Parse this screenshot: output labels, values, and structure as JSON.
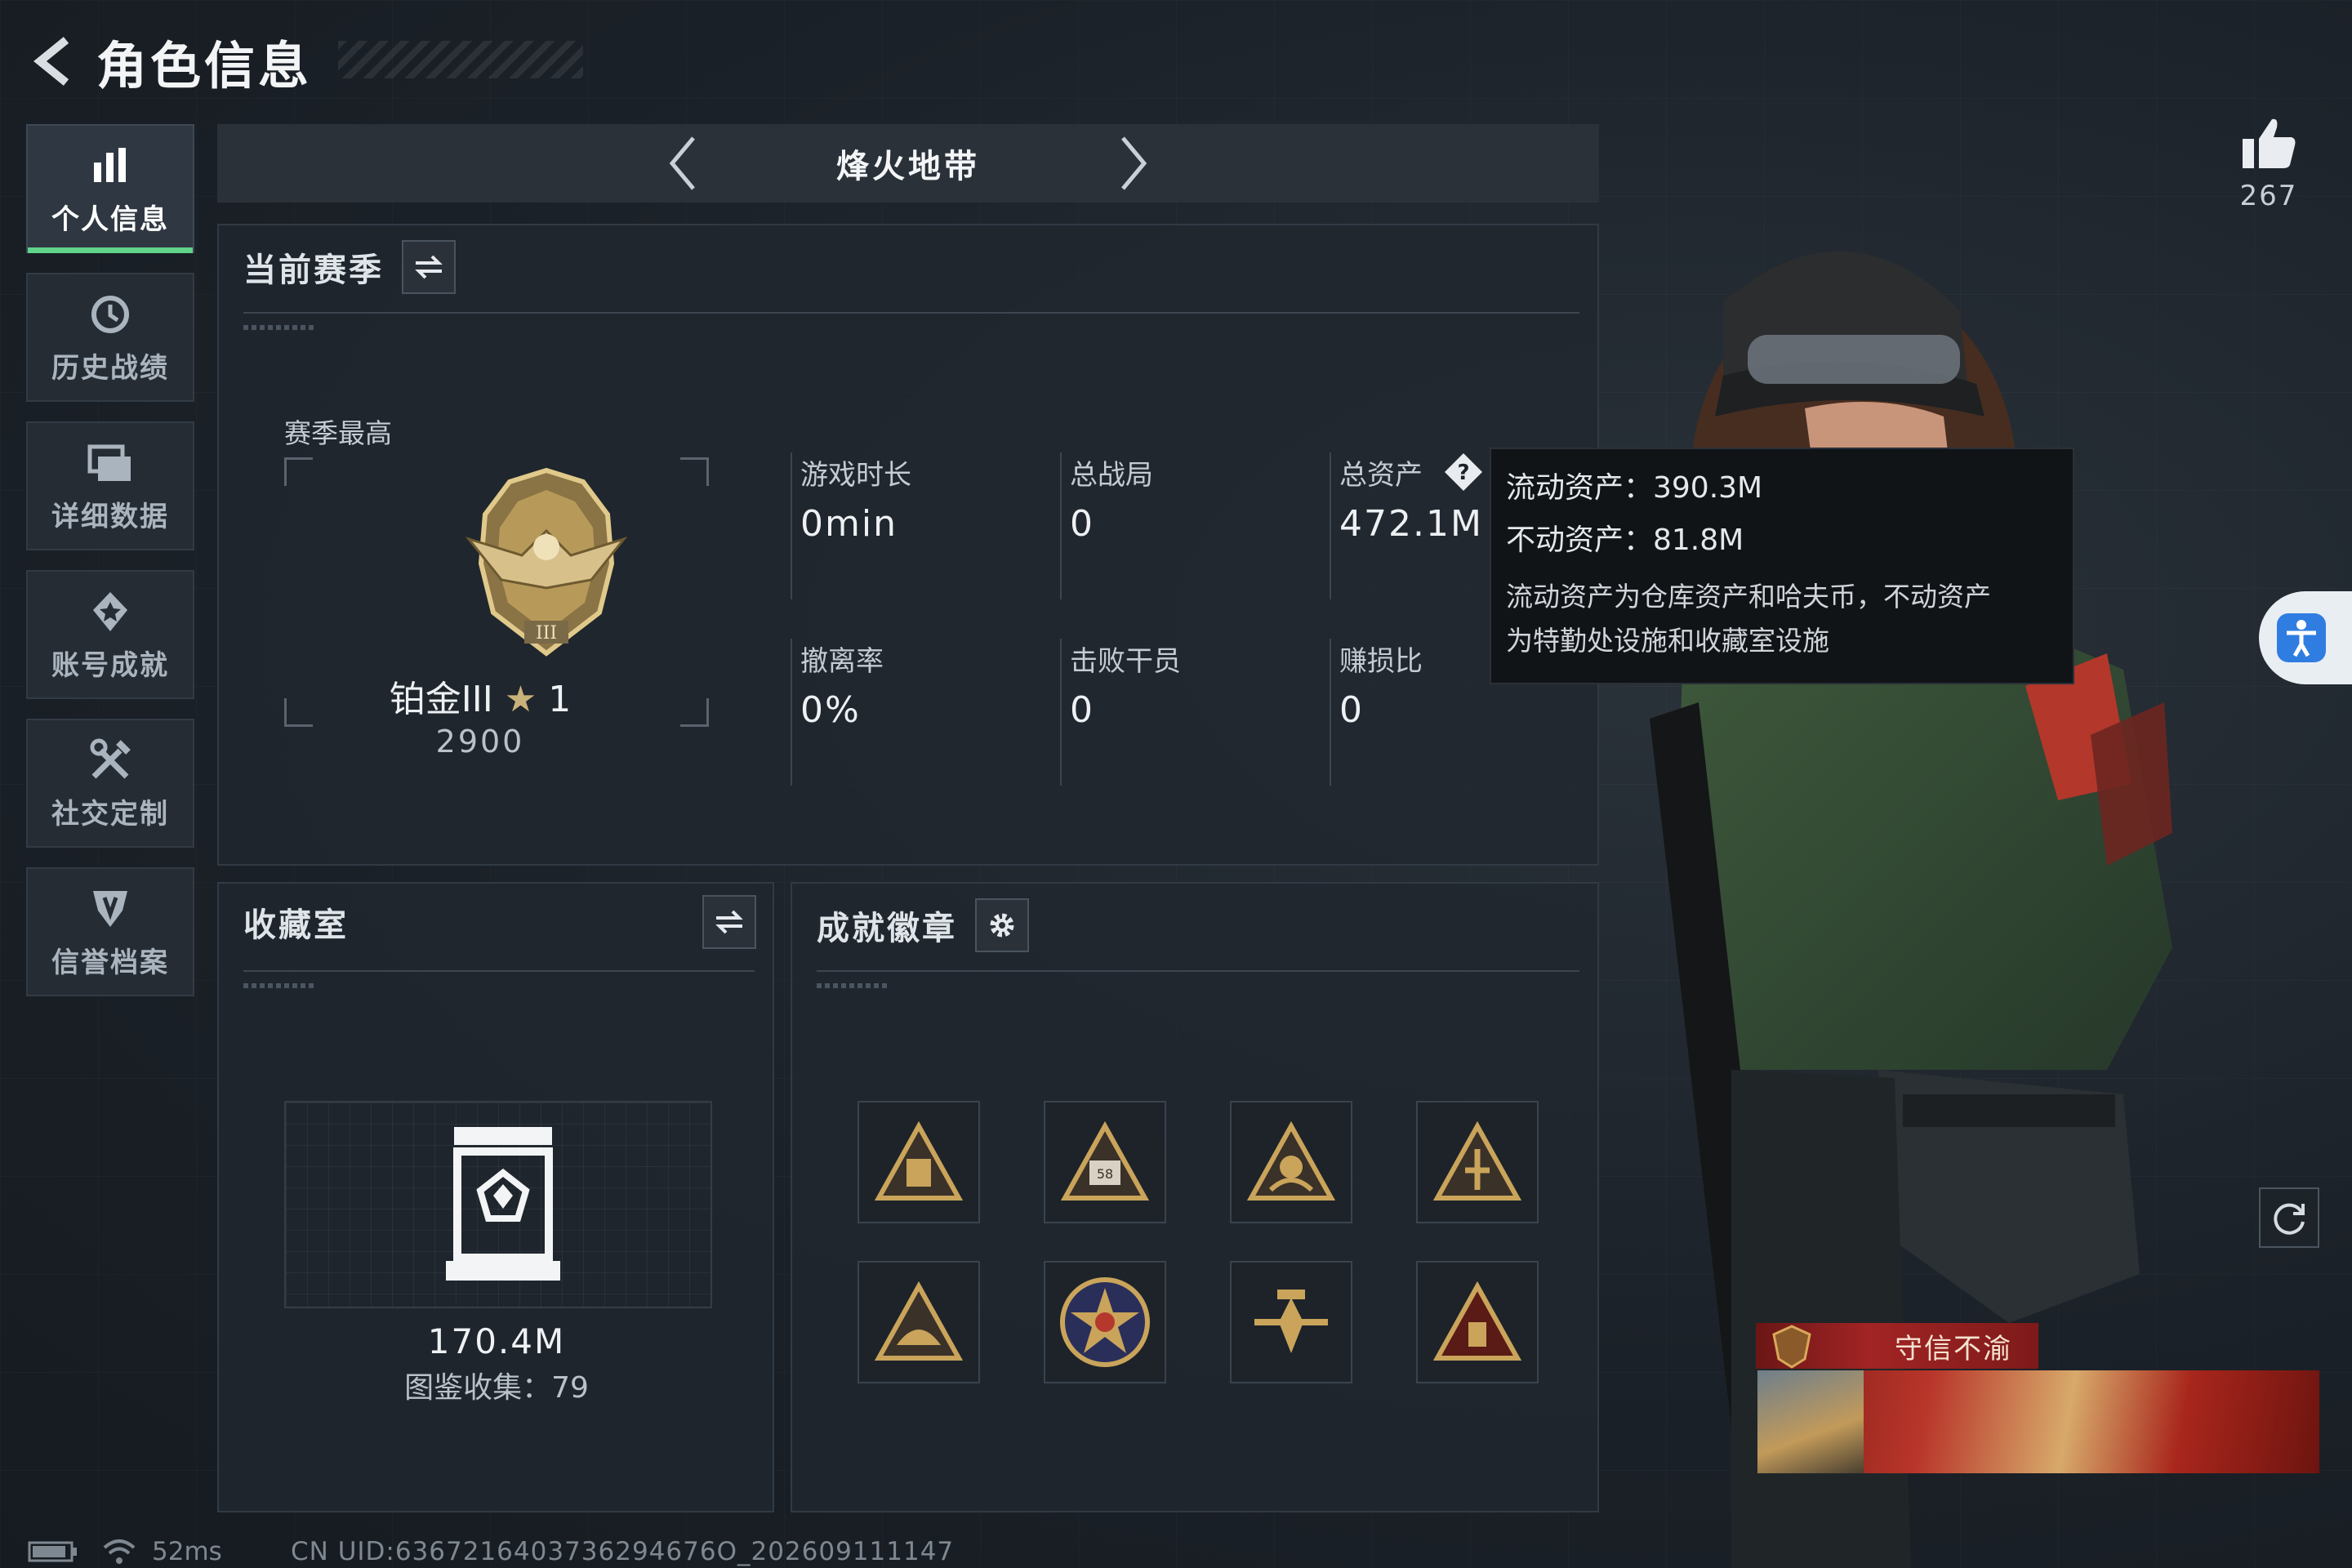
{
  "header": {
    "title": "角色信息"
  },
  "sidebar": {
    "items": [
      {
        "label": "个人信息",
        "icon": "bar-chart-icon",
        "active": true
      },
      {
        "label": "历史战绩",
        "icon": "history-clock-icon"
      },
      {
        "label": "详细数据",
        "icon": "folders-icon"
      },
      {
        "label": "账号成就",
        "icon": "achievement-star-icon"
      },
      {
        "label": "社交定制",
        "icon": "tools-icon"
      },
      {
        "label": "信誉档案",
        "icon": "credit-shield-icon"
      }
    ]
  },
  "mode": {
    "title": "烽火地带"
  },
  "season": {
    "title": "当前赛季",
    "peak_label": "赛季最高",
    "rank_name": "铂金III",
    "rank_stars": "1",
    "rank_score": "2900",
    "stats": [
      {
        "label": "游戏时长",
        "value": "0min"
      },
      {
        "label": "总战局",
        "value": "0"
      },
      {
        "label": "总资产",
        "value": "472.1M"
      },
      {
        "label": "撤离率",
        "value": "0%"
      },
      {
        "label": "击败干员",
        "value": "0"
      },
      {
        "label": "赚损比",
        "value": "0"
      }
    ]
  },
  "tooltip": {
    "liquid": "流动资产：390.3M",
    "fixed": "不动资产：81.8M",
    "note_line1": "流动资产为仓库资产和哈夫币，不动资产",
    "note_line2": "为特勤处设施和收藏室设施"
  },
  "collection": {
    "title": "收藏室",
    "value": "170.4M",
    "count": "图鉴收集：79"
  },
  "badges": {
    "title": "成就徽章",
    "items": [
      "badge-1",
      "badge-2",
      "badge-3",
      "badge-4",
      "badge-5",
      "badge-6",
      "badge-7",
      "badge-8"
    ]
  },
  "likes": {
    "count": "267"
  },
  "player_title": {
    "text": "守信不渝"
  },
  "status": {
    "ping": "52ms",
    "uid": "CN UID:6367216403736294676O_202609111147"
  },
  "colors": {
    "accent_green": "#5fd48a",
    "gold": "#c9a45a",
    "title_red": "#a22424"
  }
}
